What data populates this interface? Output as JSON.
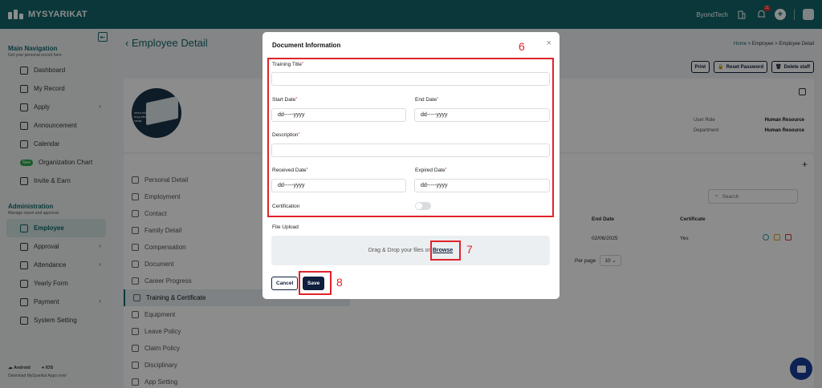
{
  "app": {
    "name": "MYSYARIKAT"
  },
  "topbar": {
    "company": "ByondTech",
    "notification_count": "11"
  },
  "sidebar": {
    "main_title": "Main Navigation",
    "main_subtitle": "Get your personal record here",
    "main_items": [
      {
        "label": "Dashboard"
      },
      {
        "label": "My Record"
      },
      {
        "label": "Apply"
      },
      {
        "label": "Announcement"
      },
      {
        "label": "Calendar"
      },
      {
        "label": "Organization Chart",
        "badge": "New"
      },
      {
        "label": "Invite & Earn"
      }
    ],
    "admin_title": "Administration",
    "admin_subtitle": "Manage report and approval",
    "admin_items": [
      {
        "label": "Employee"
      },
      {
        "label": "Approval"
      },
      {
        "label": "Attendance"
      },
      {
        "label": "Yearly Form"
      },
      {
        "label": "Payment"
      },
      {
        "label": "System Setting"
      }
    ],
    "apps": {
      "android": "Android",
      "ios": "IOS",
      "note": "Download MySyarikat Apps now!"
    }
  },
  "page": {
    "title": "Employee Detail",
    "breadcrumb": [
      "Home",
      "Employee",
      "Employee Detail"
    ],
    "actions": {
      "print": "Print",
      "reset_password": "Reset Password",
      "delete_staff": "Delete staff"
    },
    "profile": {
      "avatar_text": "ment will\nring with\nranat.",
      "user_role_label": "User Role",
      "user_role": "Human Resource",
      "department_label": "Department",
      "department": "Human Resource"
    },
    "tabs": [
      "Personal Detail",
      "Employment",
      "Contact",
      "Family Detail",
      "Compensation",
      "Document",
      "Career Progress",
      "Training & Certificate",
      "Equipment",
      "Leave Policy",
      "Claim Policy",
      "Disciplinary",
      "App Setting"
    ],
    "search_placeholder": "Search",
    "table": {
      "headers": [
        "End Date",
        "Certificate"
      ],
      "row": [
        "02/06/2025",
        "Yes"
      ]
    },
    "per_page_label": "Per page",
    "per_page_value": "10"
  },
  "modal": {
    "title": "Document Information",
    "training_title_label": "Training Title",
    "start_date_label": "Start Date",
    "end_date_label": "End Date",
    "date_placeholder": "dd-----yyyy",
    "description_label": "Description",
    "received_date_label": "Received Date",
    "expired_date_label": "Expired Date",
    "certification_label": "Certification",
    "certification_on": false,
    "file_upload_label": "File Upload",
    "drop_text": "Drag & Drop your files or",
    "browse_label": "Browse",
    "cancel_label": "Cancel",
    "save_label": "Save"
  },
  "annotations": {
    "form": "6",
    "browse": "7",
    "save": "8",
    "color": "#e0232b"
  },
  "colors": {
    "brand": "#13676a",
    "navy": "#0f1f3d",
    "danger": "#d9302c"
  }
}
